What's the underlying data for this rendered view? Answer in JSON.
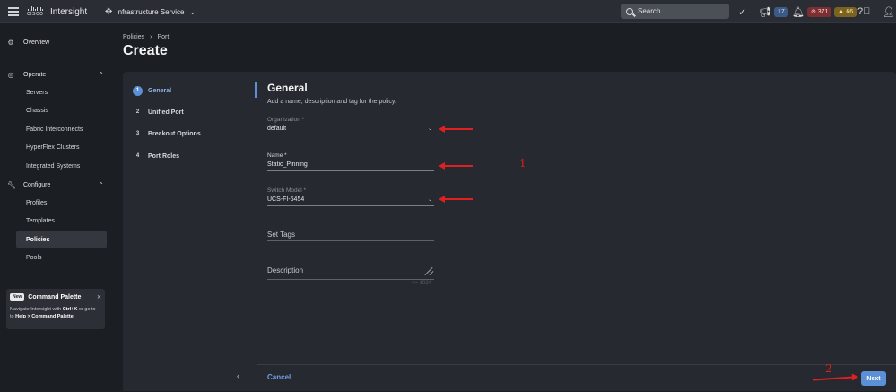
{
  "topbar": {
    "brand": "cisco",
    "app_name": "Intersight",
    "service": "Infrastructure Service",
    "search_placeholder": "Search",
    "announcements_count": "17",
    "alarms_critical": "371",
    "alarms_warning": "66"
  },
  "sidenav": {
    "overview": "Overview",
    "operate": {
      "label": "Operate",
      "items": [
        "Servers",
        "Chassis",
        "Fabric Interconnects",
        "HyperFlex Clusters",
        "Integrated Systems"
      ]
    },
    "configure": {
      "label": "Configure",
      "items": [
        "Profiles",
        "Templates",
        "Policies",
        "Pools"
      ]
    },
    "command_palette": {
      "tag": "New",
      "title": "Command Palette",
      "text_prefix": "Navigate Intersight with",
      "shortcut": "Ctrl+K",
      "text_mid": "or go to",
      "path": "Help > Command Palette"
    }
  },
  "header": {
    "breadcrumb": [
      "Policies",
      "Port"
    ],
    "title": "Create"
  },
  "wizard": {
    "steps": [
      {
        "num": "1",
        "label": "General"
      },
      {
        "num": "2",
        "label": "Unified Port"
      },
      {
        "num": "3",
        "label": "Breakout Options"
      },
      {
        "num": "4",
        "label": "Port Roles"
      }
    ]
  },
  "form": {
    "title": "General",
    "description": "Add a name, description and tag for the policy.",
    "organization": {
      "label": "Organization *",
      "value": "default"
    },
    "name": {
      "label": "Name *",
      "value": "Static_Pinning"
    },
    "switch_model": {
      "label": "Switch Model *",
      "value": "UCS-FI-6454"
    },
    "tags": {
      "placeholder": "Set Tags"
    },
    "description_field": {
      "placeholder": "Description",
      "counter": "<= 1024"
    }
  },
  "annotations": {
    "one": "1",
    "two": "2"
  },
  "footer": {
    "cancel": "Cancel",
    "next": "Next"
  },
  "colors": {
    "accent": "#5b8fd6",
    "annotation": "#e02020",
    "background": "#1b1e23",
    "panel": "#26292f"
  }
}
